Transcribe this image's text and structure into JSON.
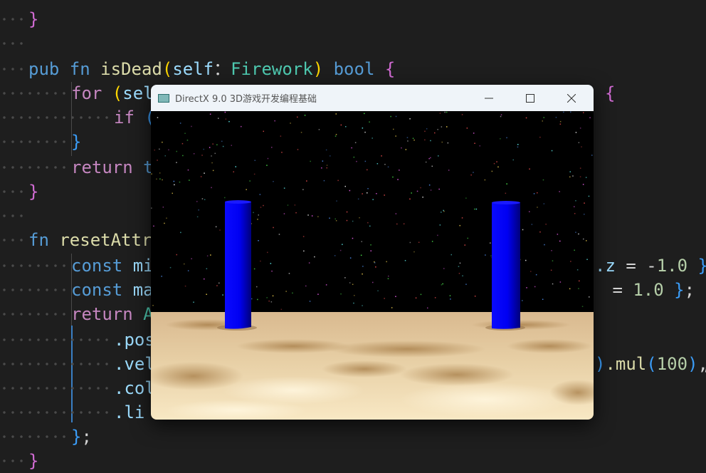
{
  "editor": {
    "lines": [
      {
        "tokens": [
          [
            "br1",
            "}"
          ]
        ]
      },
      {
        "tokens": []
      },
      {
        "tokens": [
          [
            "kw",
            "pub "
          ],
          [
            "kw",
            "fn "
          ],
          [
            "fnn",
            "isDead"
          ],
          [
            "br2",
            "("
          ],
          [
            "prm",
            "self"
          ],
          [
            "",
            "："
          ],
          [
            "typ",
            "Firework"
          ],
          [
            "br2",
            ")"
          ],
          [
            "",
            ""
          ],
          [
            "kw",
            " bool "
          ],
          [
            "br1",
            "{"
          ]
        ]
      },
      {
        "tokens": [
          [
            "ctl",
            "for "
          ],
          [
            "br2",
            "("
          ],
          [
            "prm",
            "sel"
          ]
        ]
      },
      {
        "tokens": [
          [
            "ctl",
            "if "
          ],
          [
            "br3",
            "("
          ]
        ]
      },
      {
        "tokens": [
          [
            "br3",
            "}"
          ]
        ]
      },
      {
        "tokens": [
          [
            "ctl",
            "return "
          ],
          [
            "kw",
            "t"
          ]
        ]
      },
      {
        "tokens": [
          [
            "br1",
            "}"
          ]
        ]
      },
      {
        "tokens": []
      },
      {
        "tokens": [
          [
            "kw",
            "fn "
          ],
          [
            "fnn",
            "resetAttr"
          ]
        ]
      },
      {
        "tokens": [
          [
            "kw",
            "const "
          ],
          [
            "prm",
            "mi"
          ]
        ]
      },
      {
        "tokens": [
          [
            "kw",
            "const "
          ],
          [
            "prm",
            "ma"
          ]
        ]
      },
      {
        "tokens": [
          [
            "ctl",
            "return "
          ],
          [
            "typ",
            "A"
          ]
        ]
      },
      {
        "tokens": [
          [
            "prm",
            ".pos"
          ]
        ]
      },
      {
        "tokens": [
          [
            "prm",
            ".vel"
          ]
        ]
      },
      {
        "tokens": [
          [
            "prm",
            ".col"
          ]
        ]
      },
      {
        "tokens": [
          [
            "prm",
            ".li"
          ]
        ]
      },
      {
        "tokens": [
          [
            "br3",
            "}"
          ],
          [
            "",
            ";"
          ]
        ]
      },
      {
        "tokens": [
          [
            "br1",
            "}"
          ]
        ]
      }
    ],
    "right_fragments": [
      {
        "text_parts": [
          [
            "br1",
            "{"
          ]
        ]
      },
      {
        "text_parts": [
          [
            "prm",
            ".z"
          ],
          [
            "",
            " = "
          ],
          [
            "",
            "-"
          ],
          [
            "num",
            "1.0"
          ],
          [
            "",
            " "
          ],
          [
            "br3",
            "}"
          ]
        ]
      },
      {
        "text_parts": [
          [
            "",
            " = "
          ],
          [
            "num",
            "1.0"
          ],
          [
            "",
            " "
          ],
          [
            "br3",
            "}"
          ],
          [
            "",
            ";"
          ]
        ]
      },
      {
        "text_parts": [
          [
            "br3",
            ")"
          ],
          [
            "fnn",
            ".mul"
          ],
          [
            "br3",
            "("
          ],
          [
            "num",
            "100"
          ],
          [
            "br3",
            ")"
          ],
          [
            "",
            ","
          ]
        ]
      },
      {
        "text_parts": [
          [
            "",
            ","
          ]
        ]
      }
    ]
  },
  "window": {
    "title": "DirectX 9.0 3D游戏开发编程基础",
    "minimize_icon": "minimize-icon",
    "maximize_icon": "maximize-icon",
    "close_icon": "close-icon"
  },
  "scene": {
    "sky_color": "#000000",
    "pillar_color": "#0000ff",
    "ground_color": "#e8c99a"
  }
}
